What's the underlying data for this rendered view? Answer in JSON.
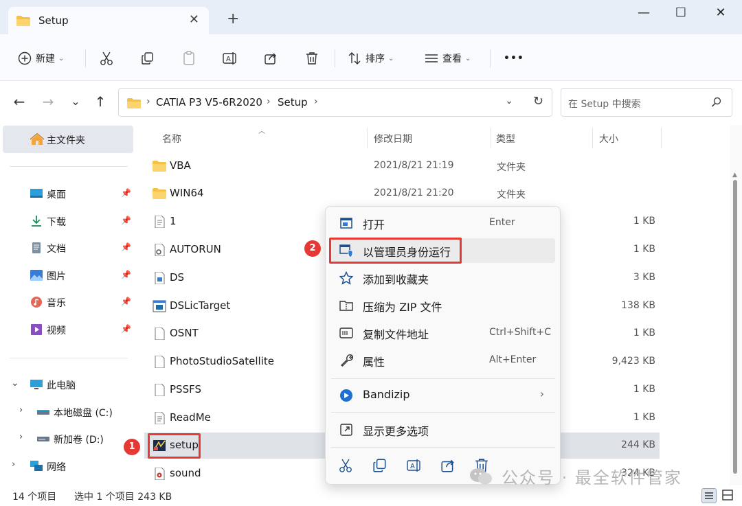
{
  "window": {
    "tab_title": "Setup",
    "new_tab": "+"
  },
  "commandbar": {
    "new_label": "新建",
    "sort_label": "排序",
    "view_label": "查看",
    "more": "•••"
  },
  "address": {
    "crumbs": [
      "CATIA P3 V5-6R2020",
      "Setup"
    ],
    "search_placeholder": "在 Setup 中搜索"
  },
  "sidebar": {
    "home": "主文件夹",
    "quick": [
      {
        "label": "桌面",
        "icon": "desktop-icon"
      },
      {
        "label": "下载",
        "icon": "download-icon"
      },
      {
        "label": "文档",
        "icon": "document-icon"
      },
      {
        "label": "图片",
        "icon": "pictures-icon"
      },
      {
        "label": "音乐",
        "icon": "music-icon"
      },
      {
        "label": "视频",
        "icon": "video-icon"
      }
    ],
    "this_pc": "此电脑",
    "drives": [
      "本地磁盘 (C:)",
      "新加卷 (D:)"
    ],
    "network": "网络"
  },
  "columns": {
    "name": "名称",
    "date": "修改日期",
    "type": "类型",
    "size": "大小"
  },
  "files": [
    {
      "name": "VBA",
      "date": "2021/8/21 21:19",
      "type": "文件夹",
      "size": "",
      "icon": "folder-icon"
    },
    {
      "name": "WIN64",
      "date": "2021/8/21 21:20",
      "type": "文件夹",
      "size": "",
      "icon": "folder-icon"
    },
    {
      "name": "1",
      "date": "",
      "type": "",
      "size": "1 KB",
      "icon": "text-file-icon"
    },
    {
      "name": "AUTORUN",
      "date": "",
      "type": "",
      "size": "1 KB",
      "icon": "settings-file-icon"
    },
    {
      "name": "DS",
      "date": "",
      "type": "",
      "size": "3 KB",
      "icon": "app-file-icon"
    },
    {
      "name": "DSLicTarget",
      "date": "",
      "type": "",
      "size": "138 KB",
      "icon": "exe-icon"
    },
    {
      "name": "OSNT",
      "date": "",
      "type": "",
      "size": "1 KB",
      "icon": "blank-file-icon"
    },
    {
      "name": "PhotoStudioSatellite",
      "date": "",
      "type": "",
      "size": "9,423 KB",
      "icon": "blank-file-icon"
    },
    {
      "name": "PSSFS",
      "date": "",
      "type": "",
      "size": "1 KB",
      "icon": "blank-file-icon"
    },
    {
      "name": "ReadMe",
      "date": "",
      "type": "",
      "size": "1 KB",
      "icon": "text-file-icon"
    },
    {
      "name": "setup",
      "date": "",
      "type": "",
      "size": "244 KB",
      "icon": "setup-exe-icon"
    },
    {
      "name": "sound",
      "date": "",
      "type": "",
      "size": "324 KB",
      "icon": "audio-file-icon"
    }
  ],
  "status": {
    "count": "14 个项目",
    "selected": "选中 1 个项目  243 KB"
  },
  "context_menu": {
    "open": {
      "label": "打开",
      "key": "Enter"
    },
    "run_as_admin": {
      "label": "以管理员身份运行"
    },
    "add_favorite": {
      "label": "添加到收藏夹"
    },
    "compress_zip": {
      "label": "压缩为 ZIP 文件"
    },
    "copy_path": {
      "label": "复制文件地址",
      "key": "Ctrl+Shift+C"
    },
    "properties": {
      "label": "属性",
      "key": "Alt+Enter"
    },
    "bandizip": {
      "label": "Bandizip",
      "sub": "›"
    },
    "more_options": {
      "label": "显示更多选项"
    }
  },
  "annotations": {
    "badge1": "1",
    "badge2": "2",
    "color": "#e53935"
  },
  "watermark": "公众号 · 最全软件管家"
}
